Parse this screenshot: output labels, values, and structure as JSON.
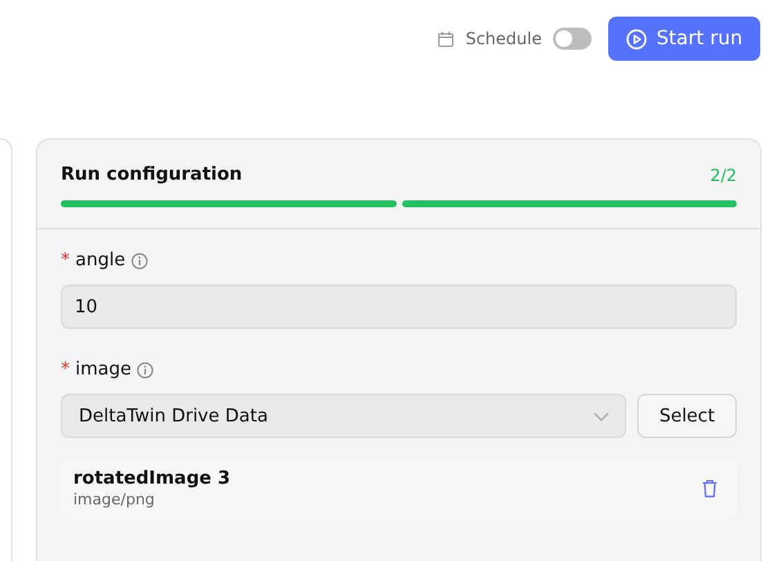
{
  "toolbar": {
    "schedule_label": "Schedule",
    "schedule_on": false,
    "start_button": "Start run"
  },
  "run_configuration": {
    "title": "Run configuration",
    "progress_text": "2/2",
    "steps": [
      {
        "done": true
      },
      {
        "done": true
      }
    ],
    "fields": [
      {
        "kind": "text",
        "label": "angle",
        "required_mark": "*",
        "value": "10"
      },
      {
        "kind": "select",
        "label": "image",
        "required_mark": "*",
        "value": "DeltaTwin Drive Data",
        "button": "Select",
        "files": [
          {
            "name": "rotatedImage 3",
            "type": "image/png"
          }
        ]
      }
    ]
  }
}
